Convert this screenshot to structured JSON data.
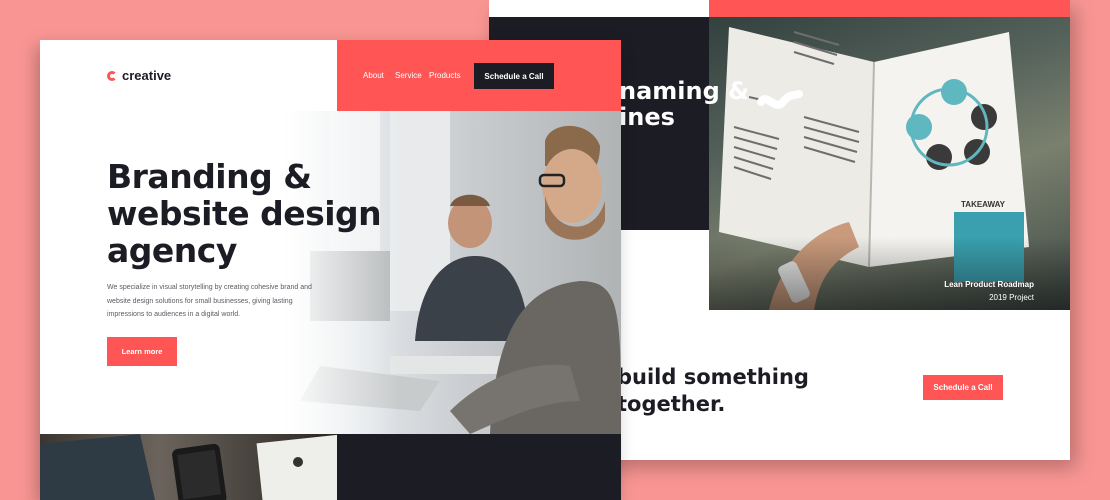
{
  "front": {
    "logo_text": "creative",
    "nav": [
      "About",
      "Service",
      "Products"
    ],
    "schedule_button": "Schedule a Call",
    "hero": {
      "title_lines": [
        "Branding &",
        "website design",
        "agency"
      ],
      "body_lines": [
        "We specialize in visual storytelling by creating cohesive brand and",
        "website design solutions for small businesses, giving lasting",
        "impressions to audiences in a digital world."
      ],
      "cta": "Learn more"
    }
  },
  "back": {
    "heading_lines": [
      "naming &",
      "ines"
    ],
    "project": {
      "title": "Lean Product Roadmap",
      "year": "2019 Project"
    },
    "book_takeaway": "TAKEAWAY",
    "cta_lines": [
      "build something",
      "together."
    ],
    "cta_button": "Schedule a Call"
  },
  "colors": {
    "accent": "#ff5555",
    "dark": "#1c1c24",
    "background": "#f99693"
  }
}
